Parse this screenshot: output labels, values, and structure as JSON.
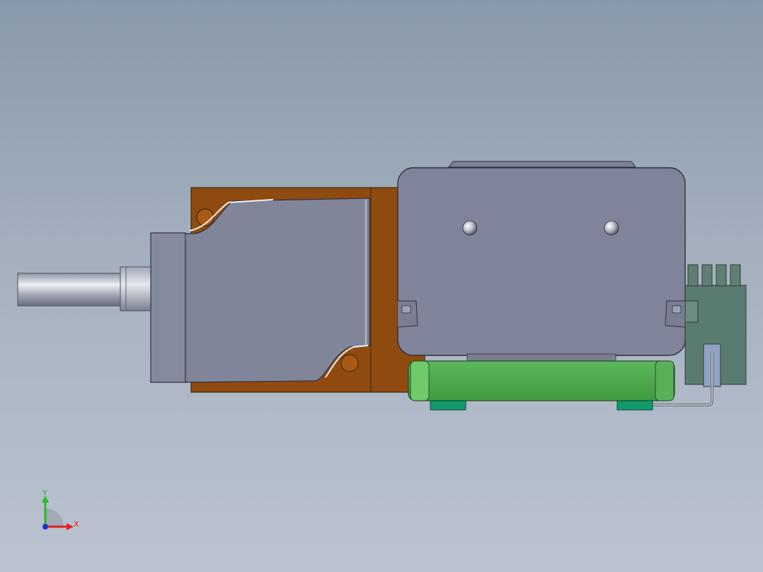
{
  "viewport": {
    "background_top": "#8899ab",
    "background_bottom": "#bcc3d0"
  },
  "model": {
    "parts": [
      {
        "name": "shaft",
        "color": "#b8bcc8"
      },
      {
        "name": "motor-housing",
        "color": "#81859a"
      },
      {
        "name": "bracket-plate",
        "color": "#8f4b0f"
      },
      {
        "name": "gearbox-cover",
        "color": "#80849a"
      },
      {
        "name": "base-block",
        "color": "#4da64d"
      },
      {
        "name": "mount-feet",
        "color": "#129a6a"
      },
      {
        "name": "connector-header",
        "color": "#5a7c70"
      },
      {
        "name": "lead-wire",
        "color": "#6b6f78"
      }
    ]
  },
  "triad": {
    "x_label": "X",
    "y_label": "Y",
    "x_color": "#e02020",
    "y_color": "#20c020",
    "z_color": "#2030d0"
  }
}
